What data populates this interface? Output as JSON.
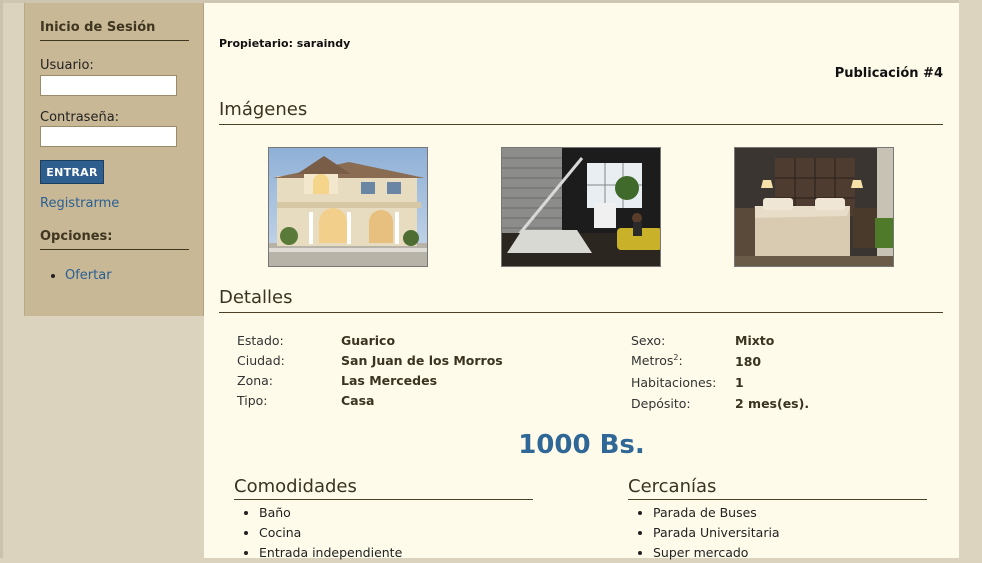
{
  "sidebar": {
    "login_title": "Inicio de Sesión",
    "user_label": "Usuario:",
    "user_value": "",
    "pass_label": "Contraseña:",
    "pass_value": "",
    "submit_label": "ENTRAR",
    "register_link": "Registrarme",
    "options_title": "Opciones:",
    "options": [
      "Ofertar"
    ]
  },
  "main": {
    "owner": "Propietario: saraindy",
    "publication": "Publicación #4",
    "images_title": "Imágenes",
    "details_title": "Detalles",
    "details_left": [
      {
        "label": "Estado:",
        "value": "Guarico"
      },
      {
        "label": "Ciudad:",
        "value": "San Juan de los Morros"
      },
      {
        "label": "Zona:",
        "value": "Las Mercedes"
      },
      {
        "label": "Tipo:",
        "value": "Casa"
      }
    ],
    "details_right": [
      {
        "label": "Sexo:",
        "value": "Mixto"
      },
      {
        "label": "Metros",
        "label_sup": "2",
        "label_suffix": ":",
        "value": "180"
      },
      {
        "label": "Habitaciones:",
        "value": "1"
      },
      {
        "label": "Depósito:",
        "value": "2 mes(es)."
      }
    ],
    "price": "1000 Bs.",
    "amenities_title": "Comodidades",
    "amenities": [
      "Baño",
      "Cocina",
      "Entrada independiente"
    ],
    "nearby_title": "Cercanías",
    "nearby": [
      "Parada de Buses",
      "Parada Universitaria",
      "Super mercado"
    ]
  },
  "colors": {
    "sidebar_bg": "#c8b896",
    "content_bg": "#fefbea",
    "page_bg": "#dcd3bf",
    "button_bg": "#2d5e8e",
    "link": "#2a5f92",
    "price": "#2f6797"
  }
}
